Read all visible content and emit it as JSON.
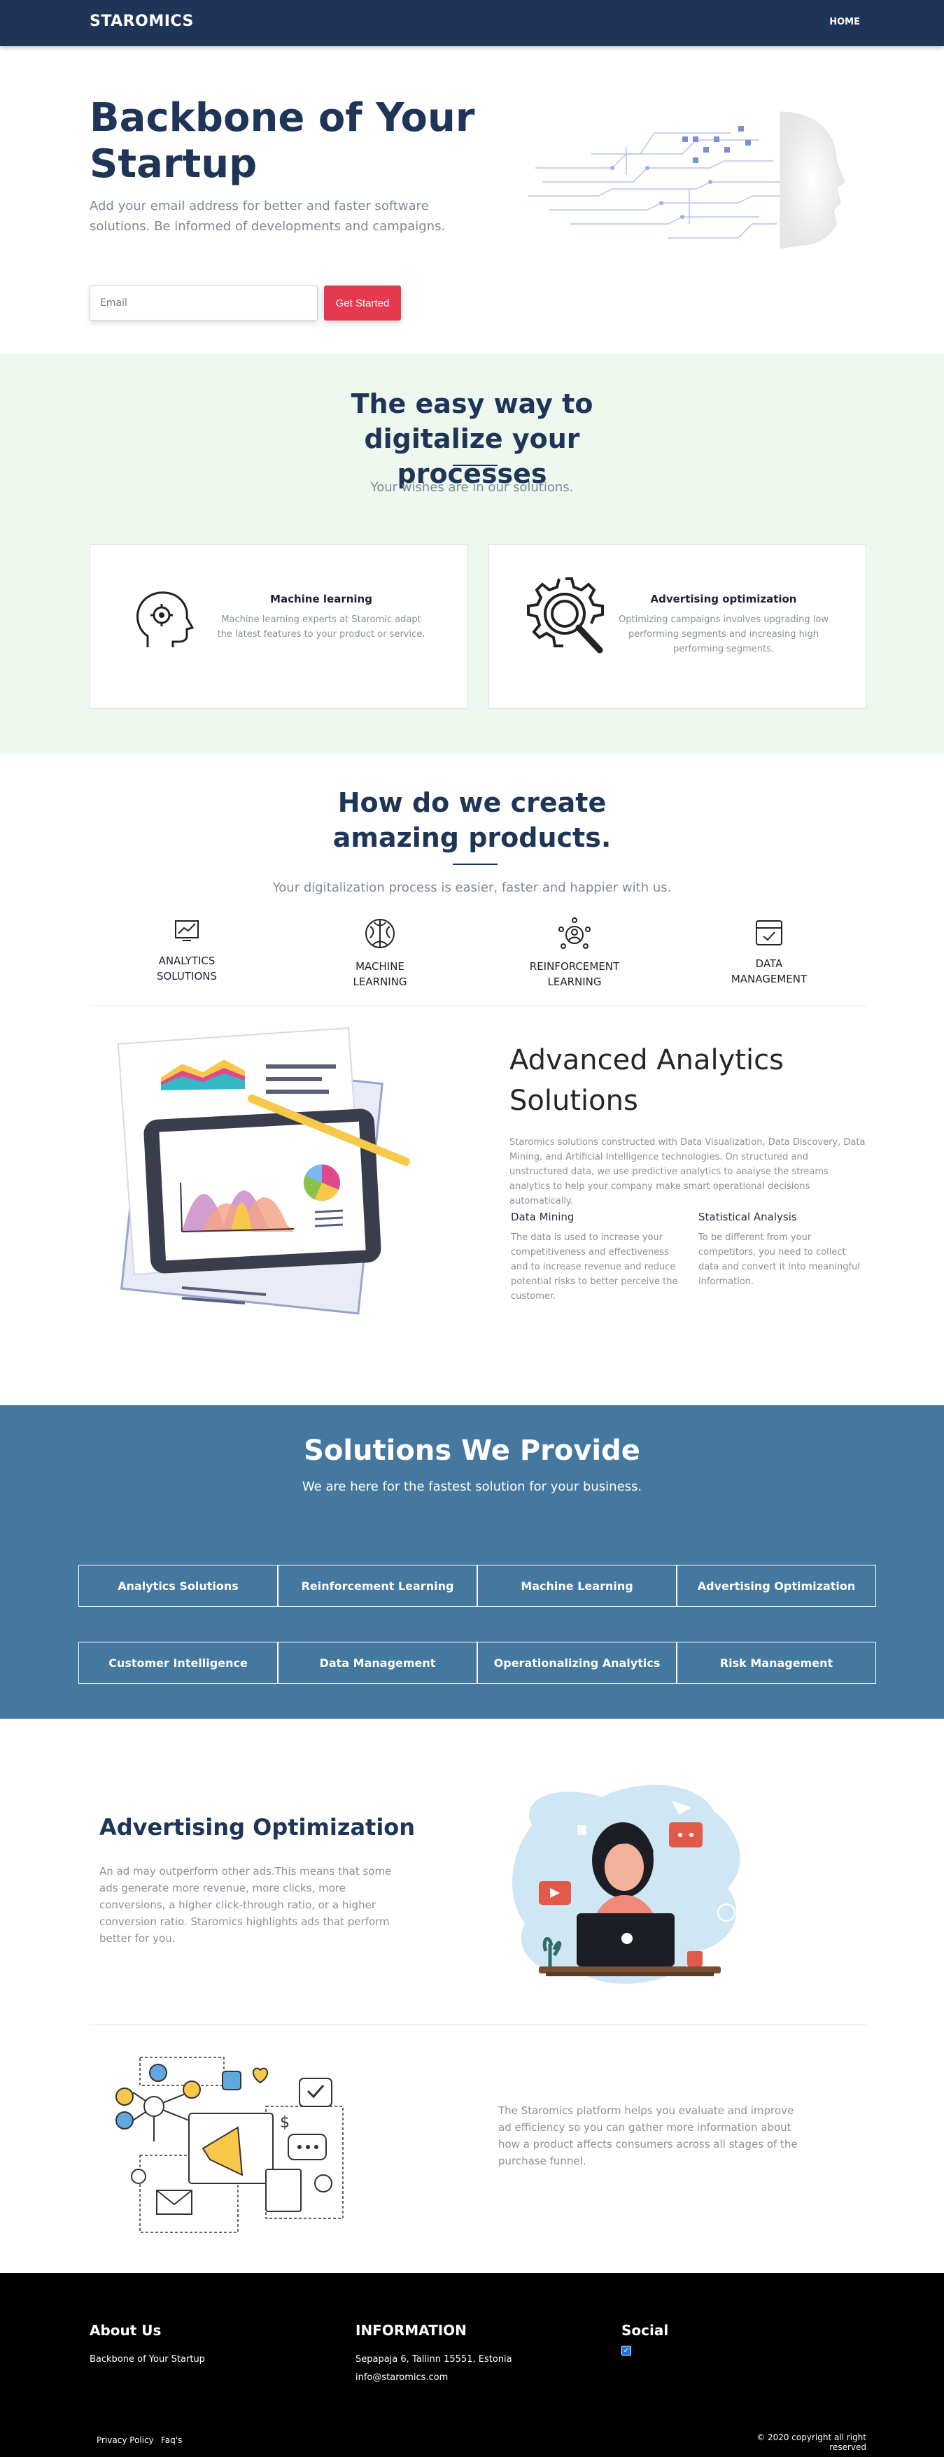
{
  "nav": {
    "brand": "STAROMICS",
    "links": [
      "HOME"
    ]
  },
  "hero": {
    "title": "Backbone of Your Startup",
    "subtitle": "Add your email address for better and faster software solutions. Be informed of developments and campaigns.",
    "email_placeholder": "Email",
    "cta": "Get Started"
  },
  "easy": {
    "title": "The easy way to digitalize your processes",
    "subtitle": "Your wishes are in our solutions.",
    "cards": [
      {
        "icon": "brain-gear-icon",
        "title": "Machine learning",
        "text": "Machine learning experts at Staromic adapt the latest features to your product or service."
      },
      {
        "icon": "gear-magnifier-icon",
        "title": "Advertising optimization",
        "text": "Optimizing campaigns involves upgrading low performing segments and increasing high performing segments."
      }
    ]
  },
  "how": {
    "title": "How do we create amazing products.",
    "subtitle": "Your digitalization process is easier, faster and happier with us.",
    "steps": [
      {
        "icon": "analytics-icon",
        "label": "ANALYTICS\nSOLUTIONS"
      },
      {
        "icon": "brain-icon",
        "label": "MACHINE\nLEARNING"
      },
      {
        "icon": "network-person-icon",
        "label": "REINFORCEMENT\nLEARNING"
      },
      {
        "icon": "data-box-icon",
        "label": "DATA\nMANAGEMENT"
      }
    ]
  },
  "analytics": {
    "title": "Advanced Analytics Solutions",
    "text": "Staromics solutions constructed with Data Visualization, Data Discovery, Data Mining, and Artificial Intelligence technologies. On structured and unstructured data, we use predictive analytics to analyse the streams analytics to help your company make smart operational decisions automatically.",
    "columns": [
      {
        "title": "Data Mining",
        "text": "The data is used to increase your competitiveness and effectiveness and to increase revenue and reduce potential risks to better perceive the customer."
      },
      {
        "title": "Statistical Analysis",
        "text": "To be different from your competitors, you need to collect data and convert it into meaningful information."
      }
    ]
  },
  "solutions": {
    "title": "Solutions We Provide",
    "subtitle": "We are here for the fastest solution for your business.",
    "items": [
      "Analytics Solutions",
      "Reinforcement Learning",
      "Machine Learning",
      "Advertising Optimization",
      "Customer Intelligence",
      "Data Management",
      "Operationalizing Analytics",
      "Risk Management"
    ]
  },
  "ads": {
    "title": "Advertising Optimization",
    "text": "An ad may outperform other ads.This means that some ads generate more revenue, more clicks, more conversions, a higher click-through ratio, or a higher conversion ratio. Staromics highlights ads that perform better for you.",
    "text2": "The Staromics platform helps you evaluate and improve ad efficiency so you can gather more information about how a product affects consumers across all stages of the purchase funnel."
  },
  "footer": {
    "about_title": "About Us",
    "about_text": "Backbone of Your Startup",
    "info_title": "INFORMATION",
    "address": "Sepapaja 6, Tallinn 15551, Estonia",
    "email": "info@staromics.com",
    "social_title": "Social",
    "links": [
      "Privacy Policy",
      "Faq's"
    ],
    "copyright": "© 2020 copyright all right reserved"
  },
  "colors": {
    "navy": "#1e3557",
    "accent": "#e53950",
    "mint": "#eef8ee",
    "steel": "#44789f"
  }
}
